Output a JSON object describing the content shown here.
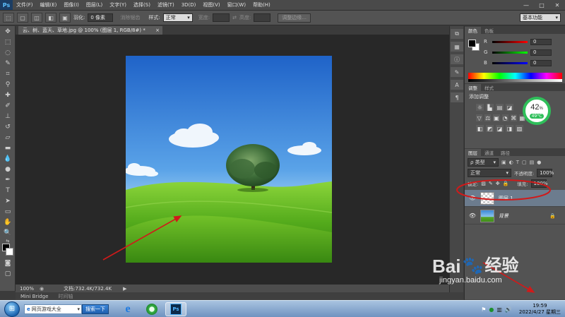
{
  "app": {
    "logo": "Ps",
    "menu": [
      "文件(F)",
      "编辑(E)",
      "图像(I)",
      "图层(L)",
      "文字(Y)",
      "选择(S)",
      "滤镜(T)",
      "3D(D)",
      "视图(V)",
      "窗口(W)",
      "帮助(H)"
    ],
    "window_controls": [
      "—",
      "□",
      "✕"
    ]
  },
  "options": {
    "feather_label": "羽化:",
    "feather_value": "0 像素",
    "antialias_label": "消除锯齿",
    "style_label": "样式:",
    "style_value": "正常",
    "width_label": "宽度:",
    "height_label": "高度:",
    "refine_edge": "调整边缘...",
    "workspace": "基本功能"
  },
  "document": {
    "tab_title": "云、树、蓝天、草地.jpg @ 100% (图层 1, RGB/8#) *",
    "close": "×",
    "zoom": "100%",
    "doc_info": "文档:732.4K/732.4K"
  },
  "bottom_tabs": [
    "Mini Bridge",
    "时间轴"
  ],
  "color_panel": {
    "tabs": [
      "颜色",
      "色板"
    ],
    "channels": [
      {
        "label": "R",
        "value": "0",
        "color": "#ff2a2a"
      },
      {
        "label": "G",
        "value": "0",
        "color": "#22cc22"
      },
      {
        "label": "B",
        "value": "0",
        "color": "#2a2aff"
      }
    ]
  },
  "adjust_panel": {
    "tabs": [
      "调整",
      "样式"
    ],
    "title": "添加调整",
    "icons_row1": [
      "☼",
      "▙",
      "▤",
      "◪"
    ],
    "icons_row2": [
      "▽",
      "⚖",
      "▣",
      "◔",
      "⌘",
      "▦"
    ],
    "icons_row3": [
      "◧",
      "◩",
      "◪",
      "◨",
      "▨"
    ]
  },
  "layers_panel": {
    "tabs": [
      "图层",
      "通道",
      "路径"
    ],
    "filter_label": "ρ 类型",
    "blend_mode": "正常",
    "opacity_label": "不透明度:",
    "opacity_value": "100%",
    "lock_label": "锁定:",
    "fill_label": "填充:",
    "fill_value": "100%",
    "layers": [
      {
        "name": "图层 1",
        "selected": true
      },
      {
        "name": "背景",
        "selected": false,
        "locked": true
      }
    ],
    "bottom_icons": [
      "⛓",
      "fx",
      "◐",
      "▢",
      "🗀",
      "▤",
      "🗑"
    ]
  },
  "system_overlay": {
    "percent": "42",
    "percent_unit": "%",
    "temp": "49°C",
    "ring_color": "#2fbf5a"
  },
  "taskbar": {
    "search_text": "网页游戏大全",
    "search_button": "搜索一下",
    "time": "19:59",
    "date": "2022/4/27 星期三"
  },
  "watermark": {
    "brand": "Bai",
    "brand2": "经验",
    "url": "jingyan.baidu.com"
  },
  "colors": {
    "annotation_red": "#d01a1a"
  }
}
